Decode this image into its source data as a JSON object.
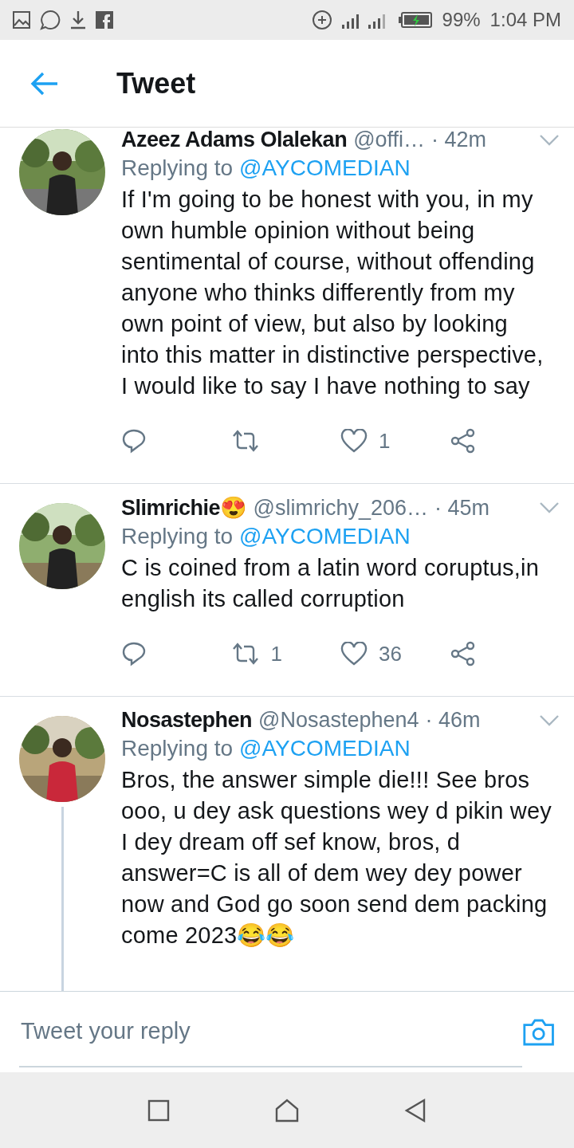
{
  "status_bar": {
    "battery": "99%",
    "time": "1:04 PM"
  },
  "header": {
    "title": "Tweet"
  },
  "tweets": [
    {
      "name": "Azeez Adams Olalekan",
      "handle": "@offi…",
      "time": "· 42m",
      "replying_label": "Replying to",
      "replying_to": "@AYCOMEDIAN",
      "body": "If I'm going to be honest with you, in my own humble opinion without being sentimental of course, without offending anyone who thinks differently from my own point of view, but also by looking into this matter in distinctive perspective, I would like to say I have nothing to say",
      "likes": "1",
      "thread": false
    },
    {
      "name": "Slimrichie😍",
      "handle": "@slimrichy_206…",
      "time": "· 45m",
      "replying_label": "Replying to",
      "replying_to": "@AYCOMEDIAN",
      "body": "C is coined from a latin word coruptus,in english its called corruption",
      "retweets": "1",
      "likes": "36",
      "thread": false
    },
    {
      "name": "Nosastephen",
      "handle": "@Nosastephen4",
      "time": "· 46m",
      "replying_label": "Replying to",
      "replying_to": "@AYCOMEDIAN",
      "body": "Bros, the answer simple die!!! See bros ooo, u dey ask questions wey d pikin wey I dey dream off sef know, bros, d answer=C is all of dem wey dey power now and God go soon send dem packing come 2023😂😂",
      "thread": true
    }
  ],
  "reply": {
    "placeholder": "Tweet your reply"
  }
}
